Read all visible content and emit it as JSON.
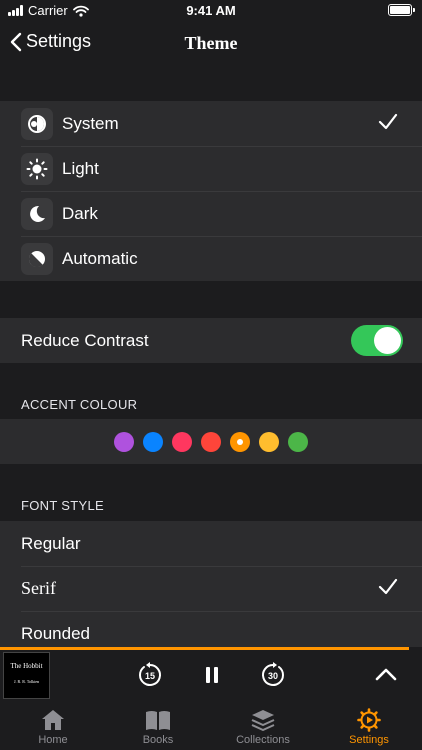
{
  "status": {
    "carrier": "Carrier",
    "time": "9:41 AM"
  },
  "nav": {
    "back_label": "Settings",
    "title": "Theme"
  },
  "theme_options": [
    {
      "label": "System",
      "icon": "system-theme-icon",
      "selected": true
    },
    {
      "label": "Light",
      "icon": "sun-icon",
      "selected": false
    },
    {
      "label": "Dark",
      "icon": "moon-icon",
      "selected": false
    },
    {
      "label": "Automatic",
      "icon": "automatic-theme-icon",
      "selected": false
    }
  ],
  "reduce_contrast": {
    "label": "Reduce Contrast",
    "on": true
  },
  "accent": {
    "header": "ACCENT COLOUR",
    "colors": [
      "#af52de",
      "#0a84ff",
      "#ff375f",
      "#ff453a",
      "#ff9500",
      "#ffbd2e",
      "#4cb648"
    ],
    "selected_index": 4
  },
  "font_style": {
    "header": "FONT STYLE",
    "options": [
      {
        "label": "Regular",
        "selected": false
      },
      {
        "label": "Serif",
        "selected": true
      },
      {
        "label": "Rounded",
        "selected": false
      }
    ]
  },
  "player": {
    "book_title": "The Hobbit",
    "author": "J. R. R. Tolkien",
    "skip_back": "15",
    "skip_forward": "30",
    "progress": 0.97
  },
  "tabs": [
    {
      "label": "Home",
      "icon": "home-icon",
      "active": false
    },
    {
      "label": "Books",
      "icon": "books-icon",
      "active": false
    },
    {
      "label": "Collections",
      "icon": "collections-icon",
      "active": false
    },
    {
      "label": "Settings",
      "icon": "settings-gear-icon",
      "active": true
    }
  ],
  "colors": {
    "accent": "#ff9500",
    "toggle_on": "#34c759",
    "background": "#1c1c1e",
    "cell": "#2c2c2e"
  }
}
